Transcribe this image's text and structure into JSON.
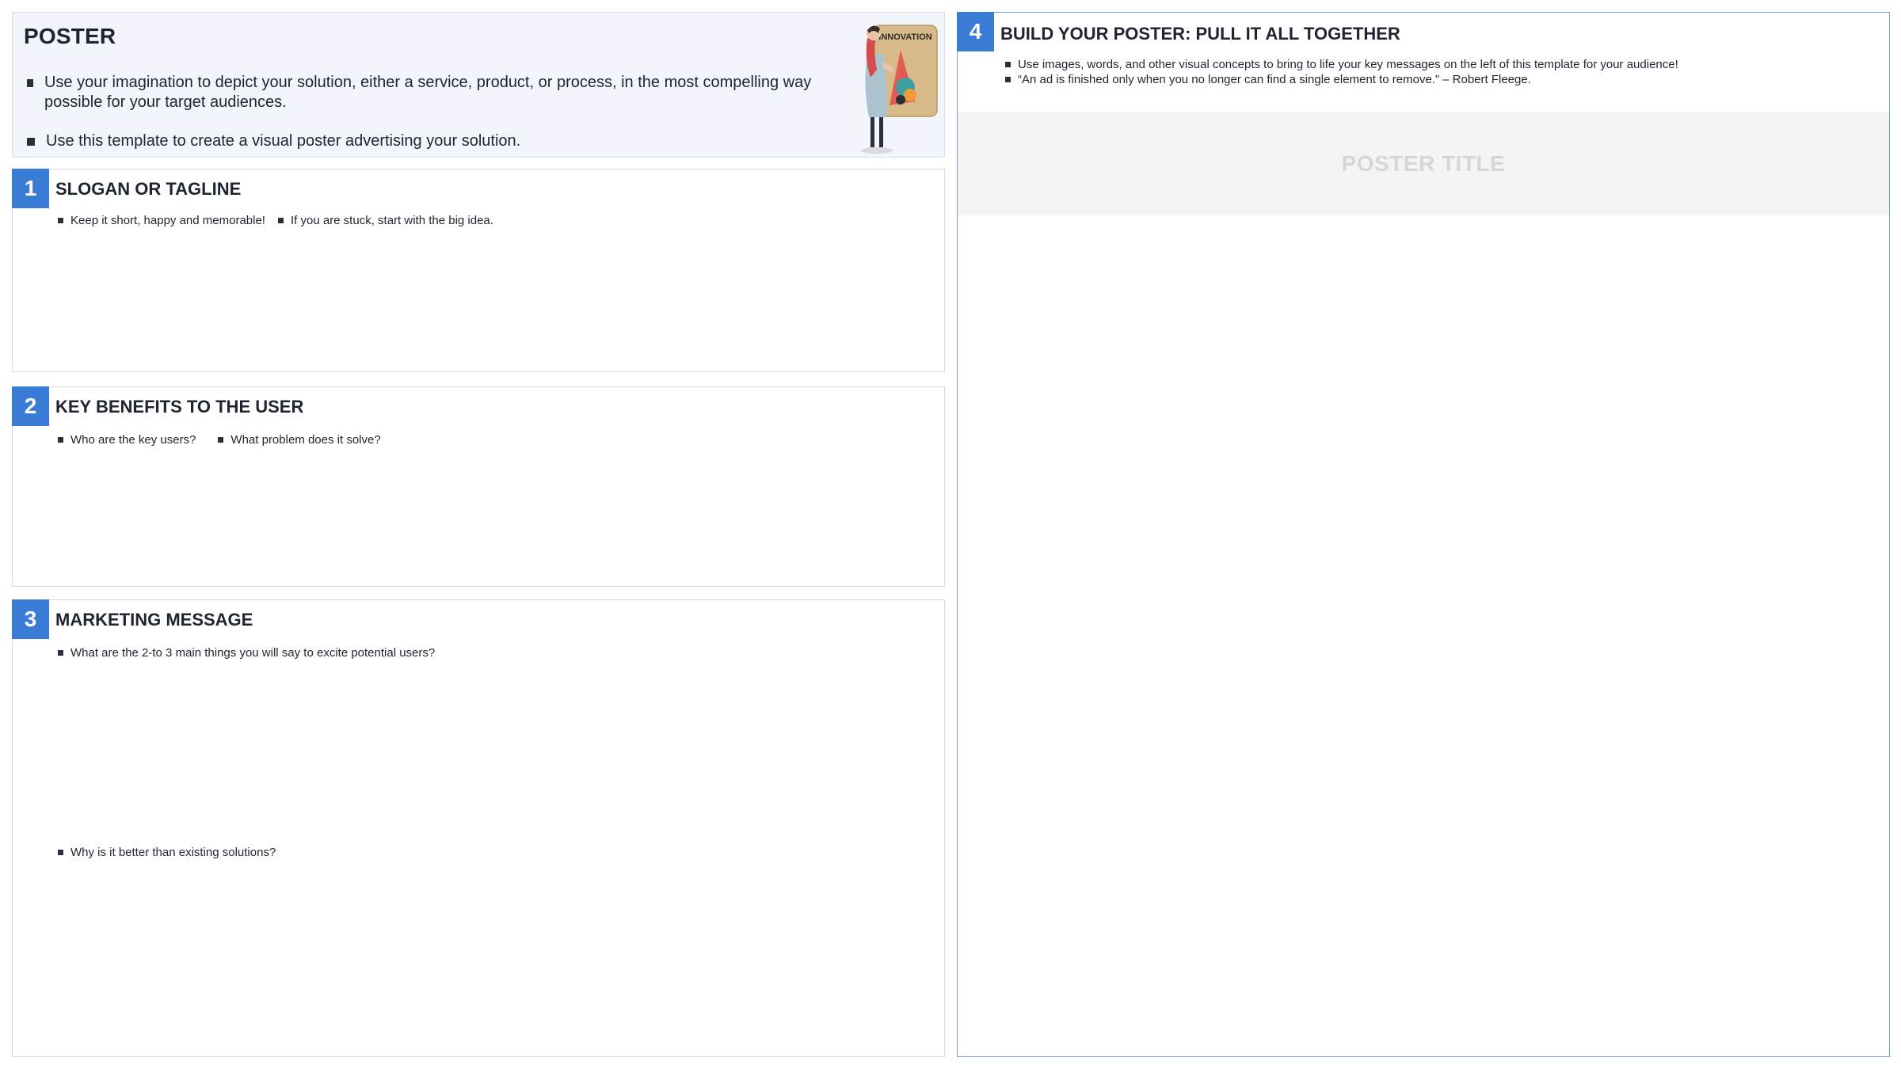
{
  "intro": {
    "title": "POSTER",
    "bullets": [
      "Use your imagination to depict your solution, either a service, product, or process, in the most compelling way possible for your target audiences.",
      "Use this template to create a visual poster advertising your solution."
    ],
    "illustration": {
      "icon": "person-holding-innovation-sign-icon",
      "sign_text": "INNOVATION"
    }
  },
  "steps": [
    {
      "number": "1",
      "title": "SLOGAN OR TAGLINE",
      "bullets": [
        "Keep it short, happy and memorable!",
        "If you are stuck, start with the big idea."
      ]
    },
    {
      "number": "2",
      "title": "KEY BENEFITS TO THE USER",
      "bullets": [
        "Who are the key users?",
        "What problem does it solve?"
      ]
    },
    {
      "number": "3",
      "title": "MARKETING MESSAGE",
      "bullets": [
        "What are the 2-to 3 main things you will say to excite potential users?"
      ],
      "bullets_lower": [
        "Why is it better than existing solutions?"
      ]
    }
  ],
  "build": {
    "number": "4",
    "title": "BUILD YOUR POSTER: PULL IT ALL TOGETHER",
    "bullets": [
      "Use images, words, and other visual concepts to bring to life your key messages on the left of this template for your audience!",
      "“An ad is finished only when you no longer can find a single element to remove.” – Robert Fleege."
    ],
    "poster_title_placeholder": "POSTER TITLE"
  },
  "colors": {
    "accent": "#3a7bd5",
    "intro_bg": "#f2f5fc",
    "text": "#1f2433",
    "placeholder_text": "#d6d6d8"
  }
}
